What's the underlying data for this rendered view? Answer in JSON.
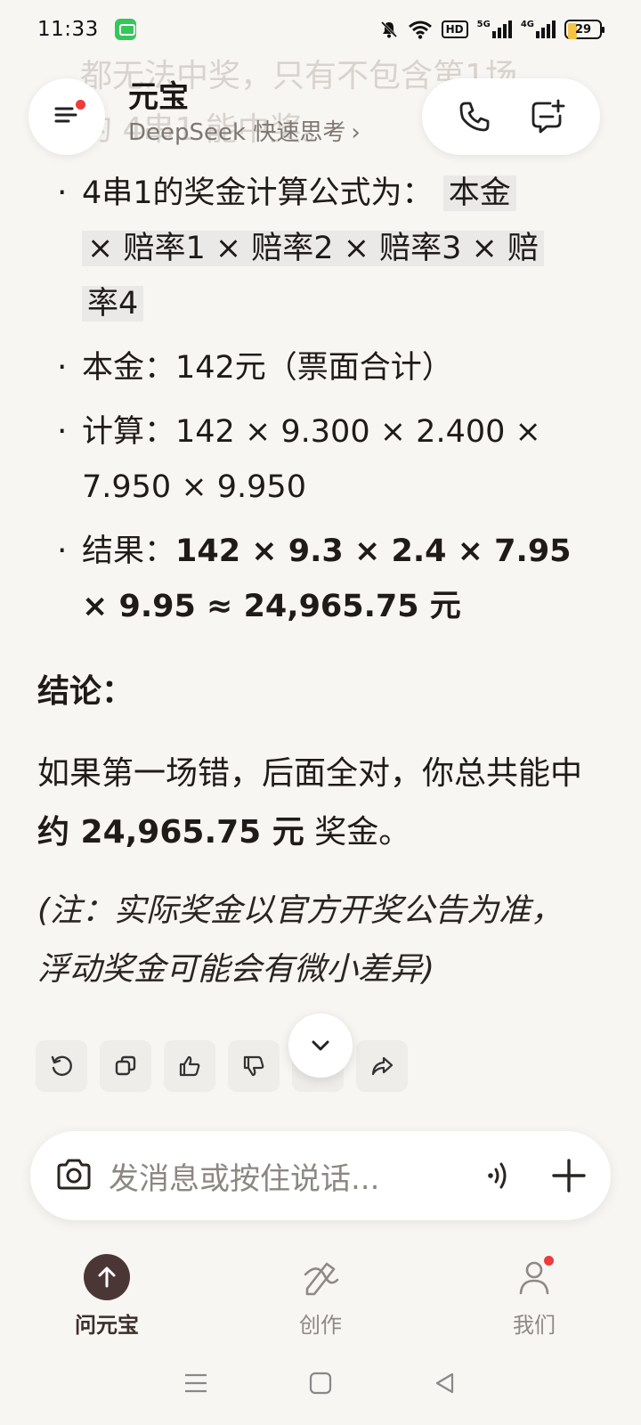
{
  "status_bar": {
    "time": "11:33",
    "hd_label": "HD",
    "net1_label": "5G",
    "net2_label": "4G",
    "battery_level": "29",
    "battery_fraction": 0.29
  },
  "header": {
    "ghost_text_1": "都无法中奖，只有不包含第1场",
    "ghost_text_2": "的 4串1 能中奖。",
    "app_title": "元宝",
    "model_label": "DeepSeek 快速思考",
    "model_chevron": "›"
  },
  "content": {
    "formula_prefix": "4串1的奖金计算公式为：",
    "formula_line1": "本金",
    "formula_line2": "× 赔率1 × 赔率2 × 赔率3 × 赔",
    "formula_line3": "率4",
    "principal": "本金：142元（票面合计）",
    "calc_label": "计算：",
    "calc_expr": "142 × 9.300 × 2.400 × 7.950 × 9.950",
    "result_label": "结果：",
    "result_expr": "142 × 9.3 × 2.4 × 7.95 × 9.95 ≈ 24,965.75 元",
    "conclusion_title": "结论：",
    "conclusion_pre": "如果第一场错，后面全对，你总共能中 ",
    "conclusion_amount": "约 24,965.75 元",
    "conclusion_post": " 奖金。",
    "note": "(注：实际奖金以官方开奖公告为准，浮动奖金可能会有微小差异)"
  },
  "input": {
    "placeholder": "发消息或按住说话..."
  },
  "bottom_nav": {
    "items": [
      {
        "label": "问元宝",
        "active": true
      },
      {
        "label": "创作",
        "active": false
      },
      {
        "label": "我们",
        "active": false
      }
    ]
  },
  "icons": {
    "menu": "menu-icon",
    "phone": "phone-icon",
    "new_chat": "new-chat-icon",
    "regenerate": "refresh-icon",
    "copy": "copy-icon",
    "like": "thumbs-up-icon",
    "dislike": "thumbs-down-icon",
    "share": "share-icon",
    "scroll_down": "chevron-down-icon",
    "camera": "camera-icon",
    "voice": "voice-icon",
    "plus": "plus-icon"
  },
  "colors": {
    "background": "#f8f6f3",
    "accent_dark": "#4a3735",
    "notification_dot": "#ef3b3b",
    "highlight": "#ebe9e8"
  }
}
